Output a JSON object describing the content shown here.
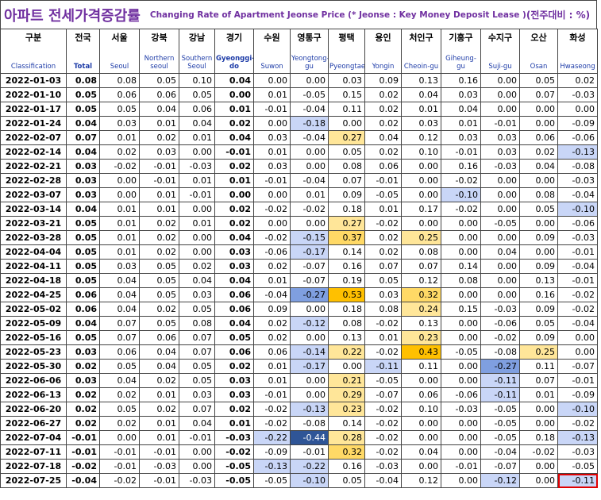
{
  "title_ko": "아파트 전세가격증감률",
  "title_en": "Changing Rate of Apartment Jeonse Price",
  "title_note": "(* Jeonse : Key Money Deposit Lease )",
  "title_unit": "(전주대비 : %)",
  "colors": {
    "title": "#7030a0",
    "header_en": "#1f3da8",
    "highlight_border": "#e00000"
  },
  "chart_data": {
    "type": "table",
    "columns": [
      {
        "ko": "구분",
        "en": "Classification"
      },
      {
        "ko": "전국",
        "en": "Total"
      },
      {
        "ko": "서울",
        "en": "Seoul"
      },
      {
        "ko": "강북",
        "en": "Northern seoul"
      },
      {
        "ko": "강남",
        "en": "Southern Seoul"
      },
      {
        "ko": "경기",
        "en": "Gyeonggi-do"
      },
      {
        "ko": "수원",
        "en": "Suwon"
      },
      {
        "ko": "영통구",
        "en": "Yeongtong-gu"
      },
      {
        "ko": "평택",
        "en": "Pyeongtaek"
      },
      {
        "ko": "용인",
        "en": "Yongin"
      },
      {
        "ko": "처인구",
        "en": "Cheoin-gu"
      },
      {
        "ko": "기흥구",
        "en": "Giheung-gu"
      },
      {
        "ko": "수지구",
        "en": "Suji-gu"
      },
      {
        "ko": "오산",
        "en": "Osan"
      },
      {
        "ko": "화성",
        "en": "Hwaseong"
      }
    ],
    "rows": [
      {
        "date": "2022-01-03",
        "values": [
          "0.08",
          "0.08",
          "0.05",
          "0.10",
          "0.04",
          "0.00",
          "0.00",
          "0.03",
          "0.09",
          "0.13",
          "0.16",
          "0.00",
          "0.05",
          "0.02"
        ]
      },
      {
        "date": "2022-01-10",
        "values": [
          "0.05",
          "0.06",
          "0.06",
          "0.05",
          "0.00",
          "0.01",
          "-0.05",
          "0.15",
          "0.02",
          "0.04",
          "0.03",
          "0.00",
          "0.07",
          "-0.03"
        ]
      },
      {
        "date": "2022-01-17",
        "values": [
          "0.05",
          "0.05",
          "0.04",
          "0.06",
          "0.01",
          "-0.01",
          "-0.04",
          "0.11",
          "0.02",
          "0.01",
          "0.04",
          "0.00",
          "0.00",
          "0.00"
        ]
      },
      {
        "date": "2022-01-24",
        "values": [
          "0.04",
          "0.03",
          "0.01",
          "0.04",
          "0.02",
          "0.00",
          "-0.18",
          "0.00",
          "0.02",
          "0.03",
          "0.01",
          "-0.01",
          "0.00",
          "-0.09"
        ]
      },
      {
        "date": "2022-02-07",
        "values": [
          "0.07",
          "0.01",
          "0.02",
          "0.01",
          "0.04",
          "0.03",
          "-0.04",
          "0.27",
          "0.04",
          "0.12",
          "0.03",
          "0.03",
          "0.06",
          "-0.06"
        ]
      },
      {
        "date": "2022-02-14",
        "values": [
          "0.04",
          "0.02",
          "0.03",
          "0.00",
          "-0.01",
          "0.01",
          "0.00",
          "0.05",
          "0.02",
          "0.10",
          "-0.01",
          "0.03",
          "0.02",
          "-0.13"
        ]
      },
      {
        "date": "2022-02-21",
        "values": [
          "0.03",
          "-0.02",
          "-0.01",
          "-0.03",
          "0.02",
          "0.03",
          "0.00",
          "0.08",
          "0.06",
          "0.00",
          "0.16",
          "-0.03",
          "0.04",
          "-0.08"
        ]
      },
      {
        "date": "2022-02-28",
        "values": [
          "0.03",
          "0.00",
          "-0.01",
          "0.01",
          "0.01",
          "-0.01",
          "-0.04",
          "0.07",
          "-0.01",
          "0.00",
          "-0.02",
          "0.00",
          "0.00",
          "-0.03"
        ]
      },
      {
        "date": "2022-03-07",
        "values": [
          "0.03",
          "0.00",
          "0.01",
          "-0.01",
          "0.00",
          "0.00",
          "0.01",
          "0.09",
          "-0.05",
          "0.00",
          "-0.10",
          "0.00",
          "0.08",
          "-0.04"
        ]
      },
      {
        "date": "2022-03-14",
        "values": [
          "0.04",
          "0.01",
          "0.01",
          "0.00",
          "0.02",
          "-0.02",
          "-0.02",
          "0.18",
          "0.01",
          "0.17",
          "-0.02",
          "0.00",
          "0.05",
          "-0.10"
        ]
      },
      {
        "date": "2022-03-21",
        "values": [
          "0.05",
          "0.01",
          "0.02",
          "0.01",
          "0.02",
          "0.00",
          "0.00",
          "0.27",
          "-0.02",
          "0.00",
          "0.00",
          "-0.05",
          "0.00",
          "-0.06"
        ]
      },
      {
        "date": "2022-03-28",
        "values": [
          "0.05",
          "0.01",
          "0.02",
          "0.00",
          "0.04",
          "-0.02",
          "-0.15",
          "0.37",
          "0.02",
          "0.25",
          "0.00",
          "0.00",
          "0.09",
          "-0.03"
        ]
      },
      {
        "date": "2022-04-04",
        "values": [
          "0.05",
          "0.01",
          "0.02",
          "0.00",
          "0.03",
          "-0.06",
          "-0.17",
          "0.14",
          "0.02",
          "0.08",
          "0.00",
          "0.04",
          "0.00",
          "-0.01"
        ]
      },
      {
        "date": "2022-04-11",
        "values": [
          "0.05",
          "0.03",
          "0.05",
          "0.02",
          "0.03",
          "0.02",
          "-0.07",
          "0.16",
          "0.07",
          "0.07",
          "0.14",
          "0.00",
          "0.09",
          "-0.04"
        ]
      },
      {
        "date": "2022-04-18",
        "values": [
          "0.05",
          "0.04",
          "0.05",
          "0.04",
          "0.04",
          "0.01",
          "-0.07",
          "0.19",
          "0.05",
          "0.12",
          "0.08",
          "0.00",
          "0.13",
          "-0.01"
        ]
      },
      {
        "date": "2022-04-25",
        "values": [
          "0.06",
          "0.04",
          "0.05",
          "0.03",
          "0.06",
          "-0.04",
          "-0.27",
          "0.53",
          "0.03",
          "0.32",
          "0.00",
          "0.00",
          "0.16",
          "-0.02"
        ]
      },
      {
        "date": "2022-05-02",
        "values": [
          "0.06",
          "0.04",
          "0.02",
          "0.05",
          "0.06",
          "0.09",
          "0.00",
          "0.18",
          "0.08",
          "0.24",
          "0.15",
          "-0.03",
          "0.09",
          "-0.02"
        ]
      },
      {
        "date": "2022-05-09",
        "values": [
          "0.04",
          "0.07",
          "0.05",
          "0.08",
          "0.04",
          "0.02",
          "-0.12",
          "0.08",
          "-0.02",
          "0.13",
          "0.00",
          "-0.06",
          "0.05",
          "-0.04"
        ]
      },
      {
        "date": "2022-05-16",
        "values": [
          "0.05",
          "0.07",
          "0.06",
          "0.07",
          "0.05",
          "0.02",
          "0.00",
          "0.13",
          "0.01",
          "0.23",
          "0.00",
          "-0.02",
          "0.09",
          "0.00"
        ]
      },
      {
        "date": "2022-05-23",
        "values": [
          "0.03",
          "0.06",
          "0.04",
          "0.07",
          "0.06",
          "0.06",
          "-0.14",
          "0.22",
          "-0.02",
          "0.43",
          "-0.05",
          "-0.08",
          "0.25",
          "0.00"
        ]
      },
      {
        "date": "2022-05-30",
        "values": [
          "0.02",
          "0.05",
          "0.04",
          "0.05",
          "0.02",
          "0.01",
          "-0.17",
          "0.00",
          "-0.11",
          "0.11",
          "0.00",
          "-0.27",
          "0.11",
          "-0.07"
        ]
      },
      {
        "date": "2022-06-06",
        "values": [
          "0.03",
          "0.04",
          "0.02",
          "0.05",
          "0.03",
          "0.01",
          "0.00",
          "0.21",
          "-0.05",
          "0.00",
          "0.00",
          "-0.11",
          "0.07",
          "-0.01"
        ]
      },
      {
        "date": "2022-06-13",
        "values": [
          "0.02",
          "0.02",
          "0.01",
          "0.03",
          "0.03",
          "-0.01",
          "0.00",
          "0.29",
          "-0.07",
          "0.06",
          "-0.06",
          "-0.11",
          "0.01",
          "-0.09"
        ]
      },
      {
        "date": "2022-06-20",
        "values": [
          "0.02",
          "0.05",
          "0.02",
          "0.07",
          "0.02",
          "-0.02",
          "-0.13",
          "0.23",
          "-0.02",
          "0.10",
          "-0.03",
          "-0.05",
          "0.00",
          "-0.10"
        ]
      },
      {
        "date": "2022-06-27",
        "values": [
          "0.02",
          "0.02",
          "0.01",
          "0.04",
          "0.01",
          "-0.02",
          "-0.08",
          "0.14",
          "-0.02",
          "0.00",
          "0.00",
          "-0.05",
          "0.00",
          "-0.02"
        ]
      },
      {
        "date": "2022-07-04",
        "values": [
          "-0.01",
          "0.00",
          "0.01",
          "-0.01",
          "-0.03",
          "-0.22",
          "-0.44",
          "0.28",
          "-0.02",
          "0.00",
          "0.00",
          "-0.05",
          "0.18",
          "-0.13"
        ]
      },
      {
        "date": "2022-07-11",
        "values": [
          "-0.01",
          "-0.01",
          "-0.01",
          "0.00",
          "-0.02",
          "-0.09",
          "-0.01",
          "0.32",
          "-0.02",
          "0.04",
          "0.00",
          "-0.04",
          "-0.02",
          "-0.03"
        ]
      },
      {
        "date": "2022-07-18",
        "values": [
          "-0.02",
          "-0.01",
          "-0.03",
          "0.00",
          "-0.05",
          "-0.13",
          "-0.22",
          "0.16",
          "-0.03",
          "0.00",
          "-0.01",
          "-0.07",
          "0.00",
          "-0.05"
        ]
      },
      {
        "date": "2022-07-25",
        "values": [
          "-0.04",
          "-0.02",
          "-0.01",
          "-0.03",
          "-0.05",
          "-0.05",
          "-0.10",
          "0.05",
          "-0.04",
          "0.12",
          "0.00",
          "-0.12",
          "0.00",
          "-0.11"
        ]
      }
    ],
    "highlighted_cell": {
      "date": "2022-07-25",
      "column": "Hwaseong"
    }
  }
}
